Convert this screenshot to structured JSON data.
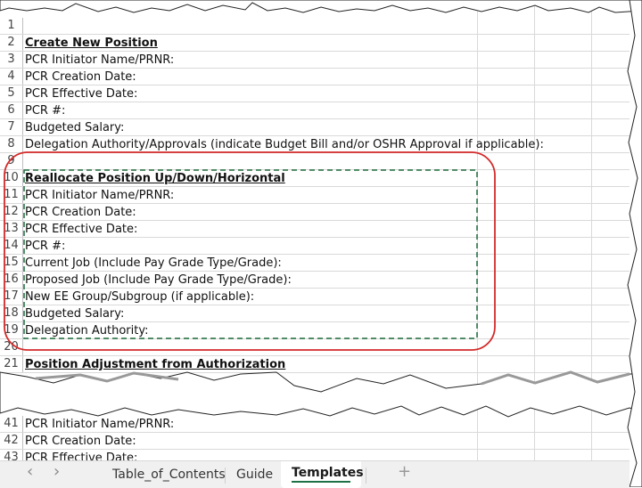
{
  "sheet_top": {
    "rows": [
      {
        "n": "1",
        "text": "",
        "bold": false
      },
      {
        "n": "2",
        "text": "Create New Position",
        "bold": true
      },
      {
        "n": "3",
        "text": "PCR Initiator Name/PRNR:",
        "bold": false
      },
      {
        "n": "4",
        "text": "PCR Creation Date:",
        "bold": false
      },
      {
        "n": "5",
        "text": "PCR Effective Date:",
        "bold": false
      },
      {
        "n": "6",
        "text": "PCR #:",
        "bold": false
      },
      {
        "n": "7",
        "text": "Budgeted Salary:",
        "bold": false
      },
      {
        "n": "8",
        "text": "Delegation Authority/Approvals (indicate Budget Bill and/or OSHR Approval if applicable):",
        "bold": false
      },
      {
        "n": "9",
        "text": "",
        "bold": false
      },
      {
        "n": "10",
        "text": "Reallocate Position Up/Down/Horizontal",
        "bold": true
      },
      {
        "n": "11",
        "text": "PCR Initiator Name/PRNR:",
        "bold": false
      },
      {
        "n": "12",
        "text": "PCR Creation Date:",
        "bold": false
      },
      {
        "n": "13",
        "text": "PCR Effective Date:",
        "bold": false
      },
      {
        "n": "14",
        "text": "PCR #:",
        "bold": false
      },
      {
        "n": "15",
        "text": "Current Job (Include Pay Grade Type/Grade):",
        "bold": false
      },
      {
        "n": "16",
        "text": "Proposed Job (Include Pay Grade Type/Grade):",
        "bold": false
      },
      {
        "n": "17",
        "text": "New EE Group/Subgroup (if applicable):",
        "bold": false
      },
      {
        "n": "18",
        "text": "Budgeted Salary:",
        "bold": false
      },
      {
        "n": "19",
        "text": "Delegation Authority:",
        "bold": false
      },
      {
        "n": "20",
        "text": "",
        "bold": false
      },
      {
        "n": "21",
        "text": "Position Adjustment from Authorization",
        "bold": true
      }
    ]
  },
  "sheet_bottom": {
    "rows": [
      {
        "n": "41",
        "text": "PCR Initiator Name/PRNR:",
        "bold": false
      },
      {
        "n": "42",
        "text": "PCR Creation Date:",
        "bold": false
      },
      {
        "n": "43",
        "text": "PCR Effective Date:",
        "bold": false
      }
    ]
  },
  "tabs": {
    "prev_icon": "‹",
    "next_icon": "›",
    "items": [
      "Table_of_Contents",
      "Guide",
      "Templates"
    ],
    "active": "Templates",
    "add_icon": "+"
  },
  "colors": {
    "highlight_circle": "#d42a2a",
    "selection_dash": "#1e6b3c",
    "active_tab_underline": "#1e7145"
  }
}
